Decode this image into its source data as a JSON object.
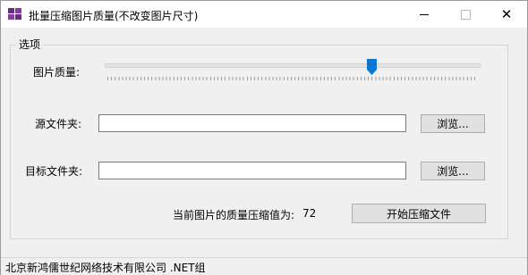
{
  "window": {
    "title": "批量压缩图片质量(不改变图片尺寸)",
    "minimize_symbol": "—",
    "close_symbol": "✕"
  },
  "options_group": {
    "legend": "选项"
  },
  "quality": {
    "label": "图片质量:",
    "value": 72,
    "min": 0,
    "max": 100
  },
  "source_folder": {
    "label": "源文件夹:",
    "value": "",
    "browse_label": "浏览..."
  },
  "target_folder": {
    "label": "目标文件夹:",
    "value": "",
    "browse_label": "浏览..."
  },
  "compression_status": {
    "label": "当前图片的质量压缩值为:",
    "value": "72"
  },
  "start_button": {
    "label": "开始压缩文件"
  },
  "statusbar": {
    "text": "北京新鸿儒世纪网络技术有限公司 .NET组"
  },
  "colors": {
    "accent": "#0078d7",
    "window_bg": "#f0f0f0",
    "button_bg": "#e1e1e1"
  }
}
